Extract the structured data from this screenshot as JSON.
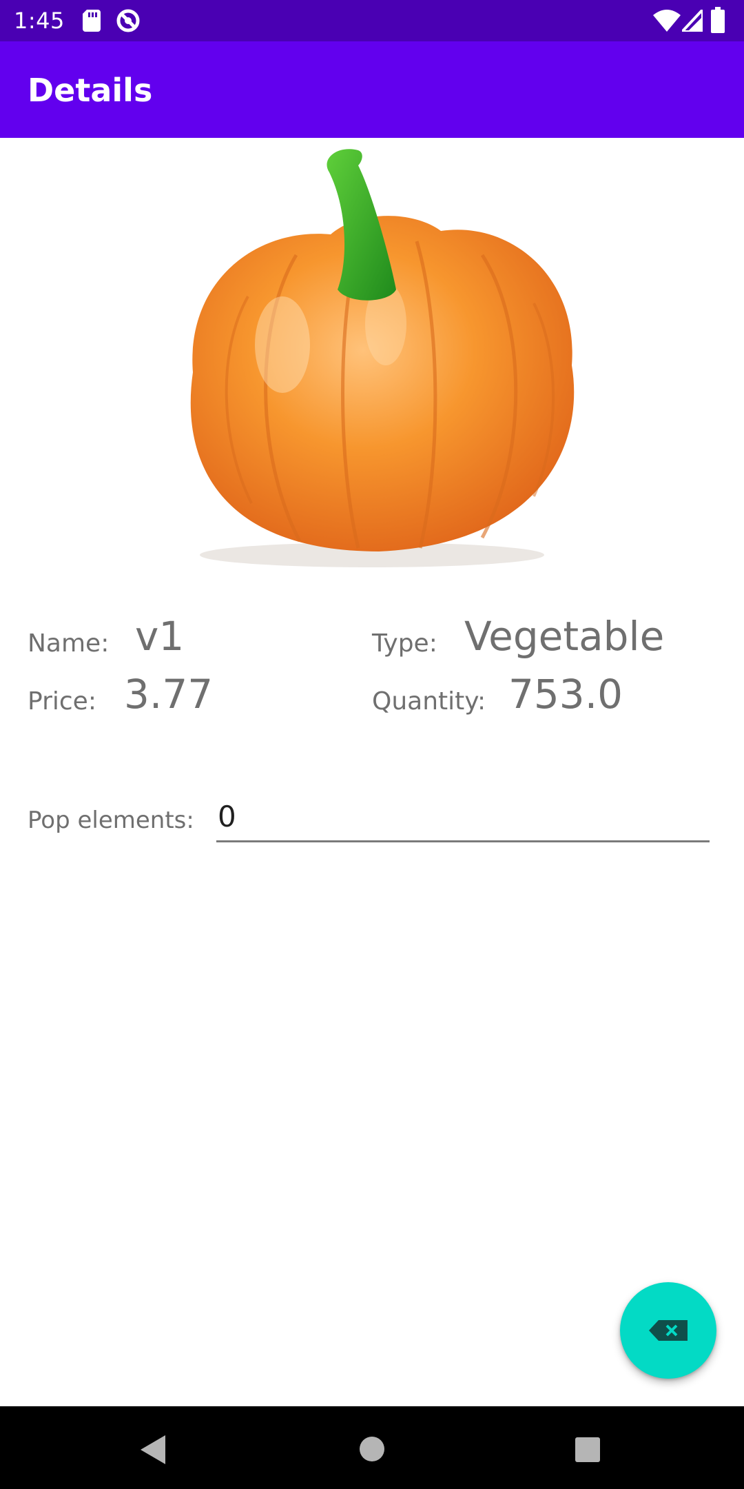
{
  "status_bar": {
    "time": "1:45",
    "icons": [
      "sd-card-icon",
      "vpn-icon",
      "wifi-icon",
      "signal-icon",
      "battery-icon"
    ]
  },
  "app_bar": {
    "title": "Details"
  },
  "product": {
    "image_icon": "pumpkin-image",
    "name_label": "Name:",
    "name_value": "v1",
    "type_label": "Type:",
    "type_value": "Vegetable",
    "price_label": "Price:",
    "price_value": "3.77",
    "quantity_label": "Quantity:",
    "quantity_value": "753.0"
  },
  "pop": {
    "label": "Pop elements:",
    "value": "0"
  },
  "fab": {
    "icon": "backspace-icon"
  },
  "nav_bar": {
    "icons": [
      "back-icon",
      "home-icon",
      "recents-icon"
    ]
  },
  "colors": {
    "status_bar": "#4a00b3",
    "app_bar": "#6200ee",
    "fab": "#03dac5",
    "text_secondary": "#6f6f6f"
  }
}
